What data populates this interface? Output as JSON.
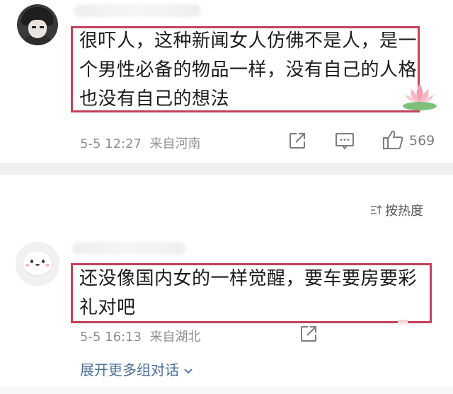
{
  "comment1": {
    "lines": [
      "很吓人，这种新闻女人仿佛不是人，是一",
      "个男性必备的物品一样，没有自己的人格",
      "也没有自己的想法"
    ],
    "date": "5-5 12:27",
    "location": "来自河南",
    "like_count": "569"
  },
  "sort": {
    "label": "按热度"
  },
  "comment2": {
    "lines": [
      "还没像国内女的一样觉醒，要车要房要彩",
      "礼对吧"
    ],
    "date": "5-5 16:13",
    "location": "来自湖北"
  },
  "expand": {
    "label": "展开更多组对话"
  },
  "icons": {
    "share": "share-icon",
    "comment": "comment-icon",
    "like": "thumbs-up-icon",
    "sort": "sort-icon",
    "chevron": "chevron-down-icon"
  },
  "colors": {
    "highlight_border": "#c4415a",
    "link_blue": "#4a6f95",
    "meta_gray": "#8f8f8f"
  }
}
